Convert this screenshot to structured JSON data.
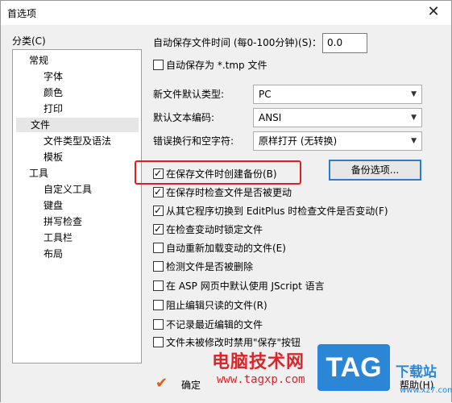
{
  "title": "首选项",
  "close_glyph": "✕",
  "sidebar": {
    "label": "分类(C)",
    "items": [
      {
        "label": "常规"
      },
      {
        "label": "字体"
      },
      {
        "label": "颜色"
      },
      {
        "label": "打印"
      },
      {
        "label": "文件"
      },
      {
        "label": "文件类型及语法"
      },
      {
        "label": "模板"
      },
      {
        "label": "工具"
      },
      {
        "label": "自定义工具"
      },
      {
        "label": "键盘"
      },
      {
        "label": "拼写检查"
      },
      {
        "label": "工具栏"
      },
      {
        "label": "布局"
      }
    ],
    "selected": "文件"
  },
  "main": {
    "autosave_label": "自动保存文件时间 (每0-100分钟)(S)：",
    "autosave_value": "0.0",
    "autosave_tmp": {
      "label": "自动保存为 *.tmp 文件",
      "checked": false
    },
    "new_file_type": {
      "label": "新文件默认类型:",
      "value": "PC"
    },
    "encoding": {
      "label": "默认文本编码:",
      "value": "ANSI"
    },
    "line_break": {
      "label": "错误换行和空字符:",
      "value": "原样打开 (无转换)"
    },
    "backup_button": "备份选项...",
    "checkboxes": [
      {
        "label": "在保存文件时创建备份(B)",
        "checked": true
      },
      {
        "label": "在保存时检查文件是否被更动",
        "checked": true
      },
      {
        "label": "从其它程序切换到 EditPlus 时检查文件是否变动(F)",
        "checked": true
      },
      {
        "label": "在检查变动时锁定文件",
        "checked": true
      },
      {
        "label": "自动重新加载变动的文件(E)",
        "checked": false
      },
      {
        "label": "检测文件是否被删除",
        "checked": false
      },
      {
        "label": "在 ASP 网页中默认使用 JScript 语言",
        "checked": false
      },
      {
        "label": "阻止编辑只读的文件(R)",
        "checked": false
      },
      {
        "label": "不记录最近编辑的文件",
        "checked": false
      },
      {
        "label": "文件未被修改时禁用\"保存\"按钮",
        "checked": false
      }
    ]
  },
  "footer": {
    "ok": "确定",
    "help": "帮助(H)"
  },
  "watermark": {
    "cn_text": "电脑技术网",
    "url": "www.tagxp.com",
    "tag": "TAG",
    "site": "下载站",
    "site_url": "www.xz7.com"
  },
  "colors": {
    "highlight": "#e02020",
    "accent_blue": "#2b86d6",
    "watermark_red": "#d9262b"
  }
}
